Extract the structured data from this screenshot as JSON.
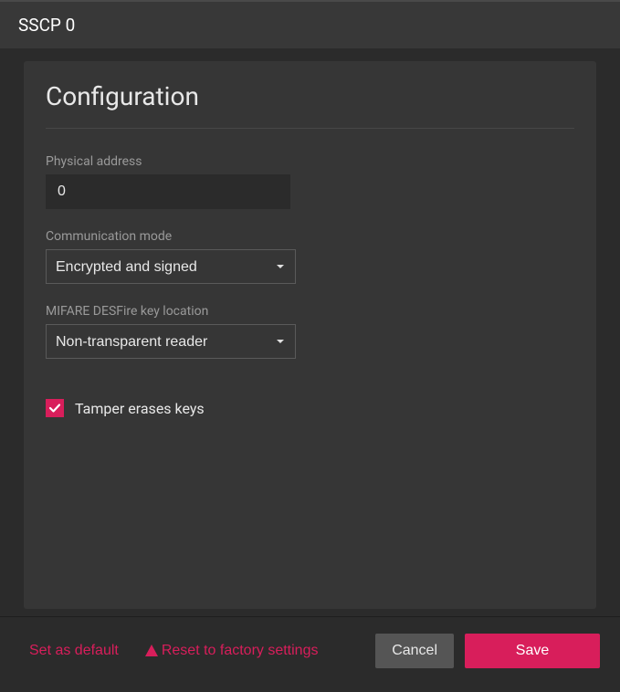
{
  "header": {
    "title": "SSCP 0"
  },
  "panel": {
    "title": "Configuration",
    "fields": {
      "physical_address": {
        "label": "Physical address",
        "value": "0"
      },
      "communication_mode": {
        "label": "Communication mode",
        "value": "Encrypted and signed"
      },
      "mifare_key_location": {
        "label": "MIFARE DESFire key location",
        "value": "Non-transparent reader"
      },
      "tamper_erases_keys": {
        "label": "Tamper erases keys",
        "checked": true
      }
    }
  },
  "footer": {
    "set_default": "Set as default",
    "reset": "Reset to factory settings",
    "cancel": "Cancel",
    "save": "Save"
  }
}
